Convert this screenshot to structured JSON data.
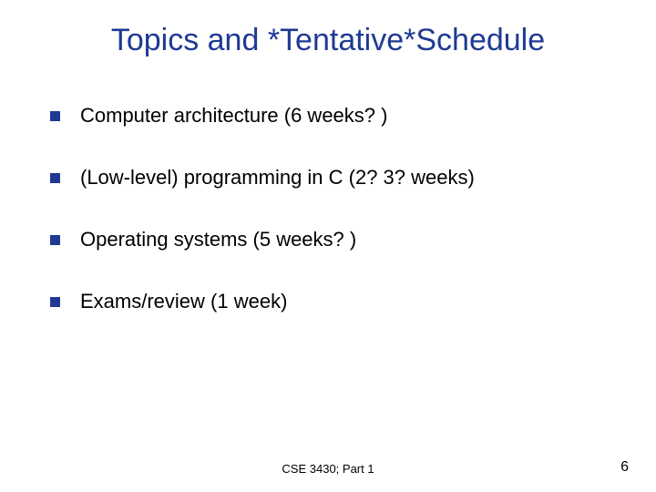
{
  "slide": {
    "title": "Topics and *Tentative*Schedule",
    "bullets": [
      "Computer architecture (6 weeks? )",
      "(Low-level) programming  in C (2? 3? weeks)",
      "Operating systems (5 weeks? )",
      "Exams/review (1 week)"
    ],
    "footer": "CSE 3430; Part 1",
    "slide_number": "6"
  },
  "colors": {
    "title": "#1f3a93",
    "bullet_marker": "#1f3a93",
    "text": "#000000"
  }
}
